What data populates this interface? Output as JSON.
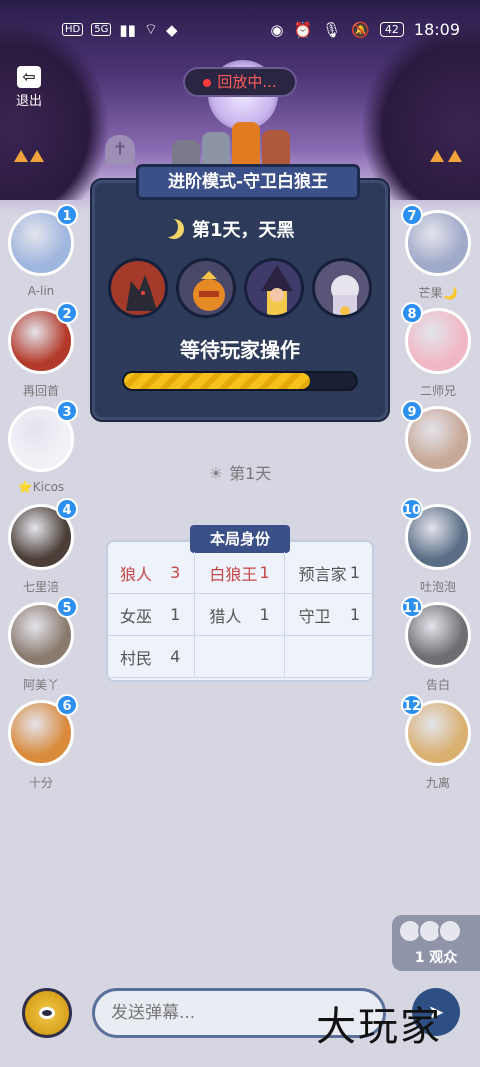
{
  "status": {
    "left_icons": [
      "HD",
      "5G"
    ],
    "battery": "42",
    "time": "18:09"
  },
  "exit_label": "退出",
  "replay_label": "回放中...",
  "board": {
    "title": "进阶模式-守卫白狼王",
    "day_text": "第1天，天黑",
    "status_text": "等待玩家操作",
    "progress": 0.8,
    "roles": [
      "werewolf",
      "white-wolf-king",
      "witch",
      "seer"
    ]
  },
  "day_separator": "第1天",
  "identity": {
    "title": "本局身份",
    "cells": [
      {
        "name": "狼人",
        "count": "3",
        "bad": true
      },
      {
        "name": "白狼王",
        "count": "1",
        "bad": true
      },
      {
        "name": "预言家",
        "count": "1",
        "bad": false
      },
      {
        "name": "女巫",
        "count": "1",
        "bad": false
      },
      {
        "name": "猎人",
        "count": "1",
        "bad": false
      },
      {
        "name": "守卫",
        "count": "1",
        "bad": false
      },
      {
        "name": "村民",
        "count": "4",
        "bad": false
      },
      {
        "name": "",
        "count": "",
        "bad": false
      },
      {
        "name": "",
        "count": "",
        "bad": false
      }
    ]
  },
  "players_left": [
    {
      "num": "1",
      "name": "A-lin",
      "color": "#9fb6df"
    },
    {
      "num": "2",
      "name": "再回首",
      "color": "#b33a2a"
    },
    {
      "num": "3",
      "name": "⭐Kicos",
      "color": "#f4f0f8"
    },
    {
      "num": "4",
      "name": "七里涪",
      "color": "#4a3e36"
    },
    {
      "num": "5",
      "name": "阿美丫",
      "color": "#8a7a6e"
    },
    {
      "num": "6",
      "name": "十分",
      "color": "#d98a3a"
    }
  ],
  "players_right": [
    {
      "num": "7",
      "name": "芒果🌙",
      "color": "#9fa9c8"
    },
    {
      "num": "8",
      "name": "二师兄",
      "color": "#f0b8c4"
    },
    {
      "num": "9",
      "name": "",
      "color": "#c8a896"
    },
    {
      "num": "10",
      "name": "吐泡泡",
      "color": "#5a6e86"
    },
    {
      "num": "11",
      "name": "告白",
      "color": "#6e6e72"
    },
    {
      "num": "12",
      "name": "九离",
      "color": "#d9b070"
    }
  ],
  "spectators": "1 观众",
  "input_placeholder": "发送弹幕...",
  "watermark": "大玩家"
}
